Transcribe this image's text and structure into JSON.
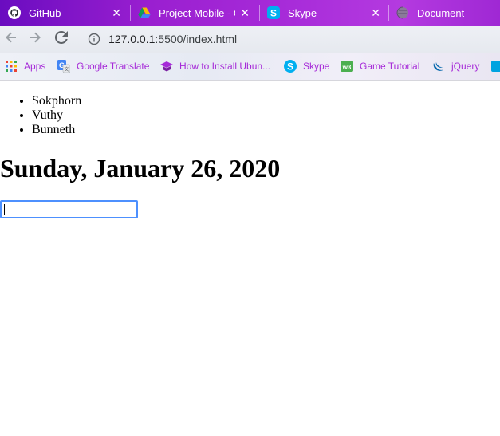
{
  "browser": {
    "tabs": [
      {
        "title": "GitHub",
        "icon": "github-icon",
        "close": "✕"
      },
      {
        "title": "Project Mobile - G",
        "icon": "google-drive-icon",
        "close": "✕"
      },
      {
        "title": "Skype",
        "icon": "skype-icon",
        "close": "✕"
      },
      {
        "title": "Document",
        "icon": "globe-icon"
      }
    ],
    "omnibox": {
      "url_host": "127.0.0.1",
      "url_rest": ":5500/index.html"
    },
    "bookmarks": [
      {
        "label": "Apps",
        "icon": "apps-grid-icon"
      },
      {
        "label": "Google Translate",
        "icon": "google-translate-icon"
      },
      {
        "label": "How to Install Ubun...",
        "icon": "graduation-cap-icon"
      },
      {
        "label": "Skype",
        "icon": "skype-icon"
      },
      {
        "label": "Game Tutorial",
        "icon": "w3schools-icon"
      },
      {
        "label": "jQuery",
        "icon": "jquery-icon"
      }
    ]
  },
  "page": {
    "names": [
      "Sokphorn",
      "Vuthy",
      "Bunneth"
    ],
    "date_heading": "Sunday, January 26, 2020",
    "input_value": ""
  },
  "colors": {
    "tab_gradient_start": "#6a0cc0",
    "tab_gradient_end": "#b43ae0",
    "bookmark_text": "#a62ad8",
    "input_focus": "#4d90fe"
  }
}
